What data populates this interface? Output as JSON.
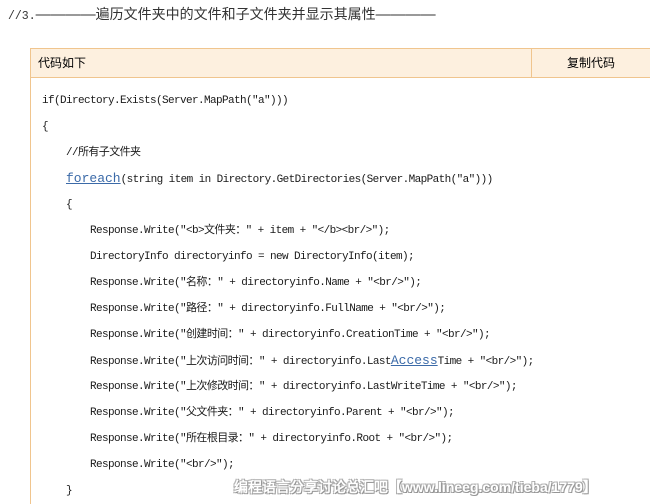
{
  "heading": {
    "number": "//3.",
    "dash_left": "————",
    "title": "遍历文件夹中的文件和子文件夹并显示其属性",
    "dash_right": "————"
  },
  "code_block": {
    "label": "代码如下",
    "copy_button": "复制代码",
    "lines": [
      {
        "text": "if(Directory.Exists(Server.MapPath(\"a\")))"
      },
      {
        "text": "{"
      },
      {
        "text": "//所有子文件夹"
      },
      {
        "link": "foreach",
        "post": "(string item in Directory.GetDirectories(Server.MapPath(\"a\")))"
      },
      {
        "text": "{"
      },
      {
        "text": "Response.Write(\"<b>文件夹：\" + item + \"</b><br/>\");"
      },
      {
        "text": "DirectoryInfo directoryinfo = new DirectoryInfo(item);"
      },
      {
        "text": "Response.Write(\"名称：\" + directoryinfo.Name + \"<br/>\");"
      },
      {
        "text": "Response.Write(\"路径：\" + directoryinfo.FullName + \"<br/>\");"
      },
      {
        "text": "Response.Write(\"创建时间：\" + directoryinfo.CreationTime + \"<br/>\");"
      },
      {
        "pre": "Response.Write(\"上次访问时间：\" + directoryinfo.Last",
        "link": "Access",
        "post": "Time + \"<br/>\");"
      },
      {
        "text": "Response.Write(\"上次修改时间：\" + directoryinfo.LastWriteTime + \"<br/>\");"
      },
      {
        "text": "Response.Write(\"父文件夹：\" + directoryinfo.Parent + \"<br/>\");"
      },
      {
        "text": "Response.Write(\"所在根目录：\" + directoryinfo.Root + \"<br/>\");"
      },
      {
        "text": "Response.Write(\"<br/>\");"
      },
      {
        "text": "}"
      }
    ]
  },
  "watermark": "编程语言分享讨论总汇吧【www.lineeg.com/tieba/1779】",
  "colors": {
    "header_background": "#fdf0df",
    "border": "#f0c58e",
    "link": "#3b6aa8",
    "code_text": "#1a1a1a"
  }
}
